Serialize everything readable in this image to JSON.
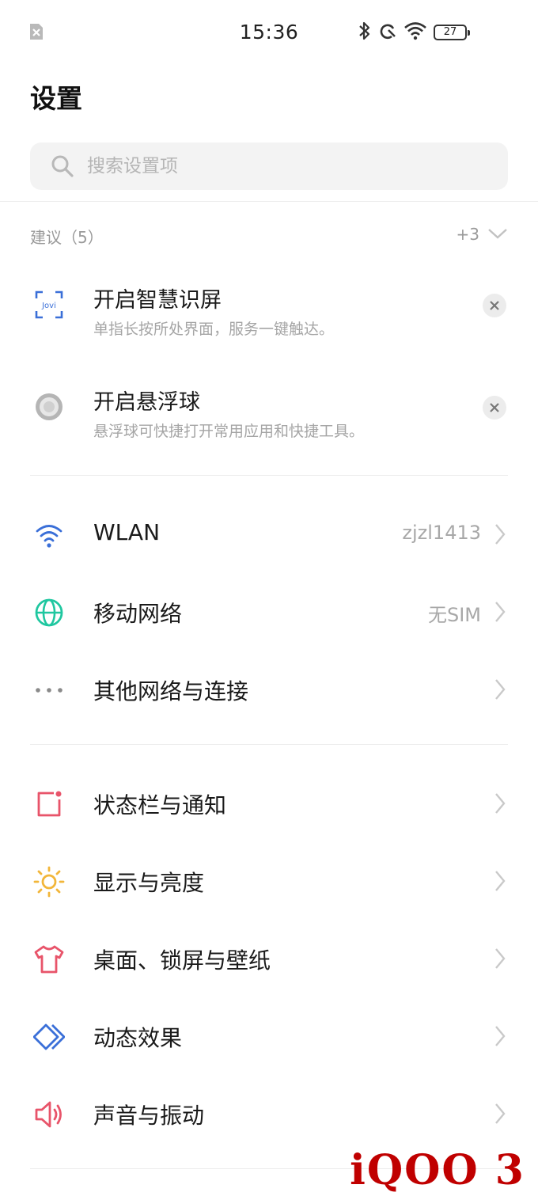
{
  "status_bar": {
    "time": "15:36",
    "battery": "27",
    "icons": [
      "no-sim-icon",
      "bluetooth-icon",
      "do-not-disturb-icon",
      "wifi-icon",
      "battery-icon"
    ]
  },
  "page": {
    "title": "设置"
  },
  "search": {
    "placeholder": "搜索设置项"
  },
  "suggestions": {
    "title": "建议（5）",
    "more": "+3",
    "items": [
      {
        "title": "开启智慧识屏",
        "subtitle": "单指长按所处界面，服务一键触达。",
        "icon": "jovi-icon",
        "icon_text": "Jovi"
      },
      {
        "title": "开启悬浮球",
        "subtitle": "悬浮球可快捷打开常用应用和快捷工具。",
        "icon": "floating-ball-icon"
      }
    ]
  },
  "network": {
    "items": [
      {
        "label": "WLAN",
        "value": "zjzl1413",
        "icon": "wifi-icon"
      },
      {
        "label": "移动网络",
        "value": "无SIM",
        "icon": "globe-icon"
      },
      {
        "label": "其他网络与连接",
        "value": "",
        "icon": "more-dots-icon"
      }
    ]
  },
  "system": {
    "items": [
      {
        "label": "状态栏与通知",
        "icon": "notification-icon"
      },
      {
        "label": "显示与亮度",
        "icon": "sun-icon"
      },
      {
        "label": "桌面、锁屏与壁纸",
        "icon": "tshirt-icon"
      },
      {
        "label": "动态效果",
        "icon": "diamond-icon"
      },
      {
        "label": "声音与振动",
        "icon": "speaker-icon"
      }
    ]
  },
  "watermark": "iQOO 3",
  "colors": {
    "blue": "#3a6fd8",
    "teal": "#1fc7a0",
    "red": "#e8546a",
    "amber": "#f2b63a",
    "watermark": "#c00000"
  }
}
